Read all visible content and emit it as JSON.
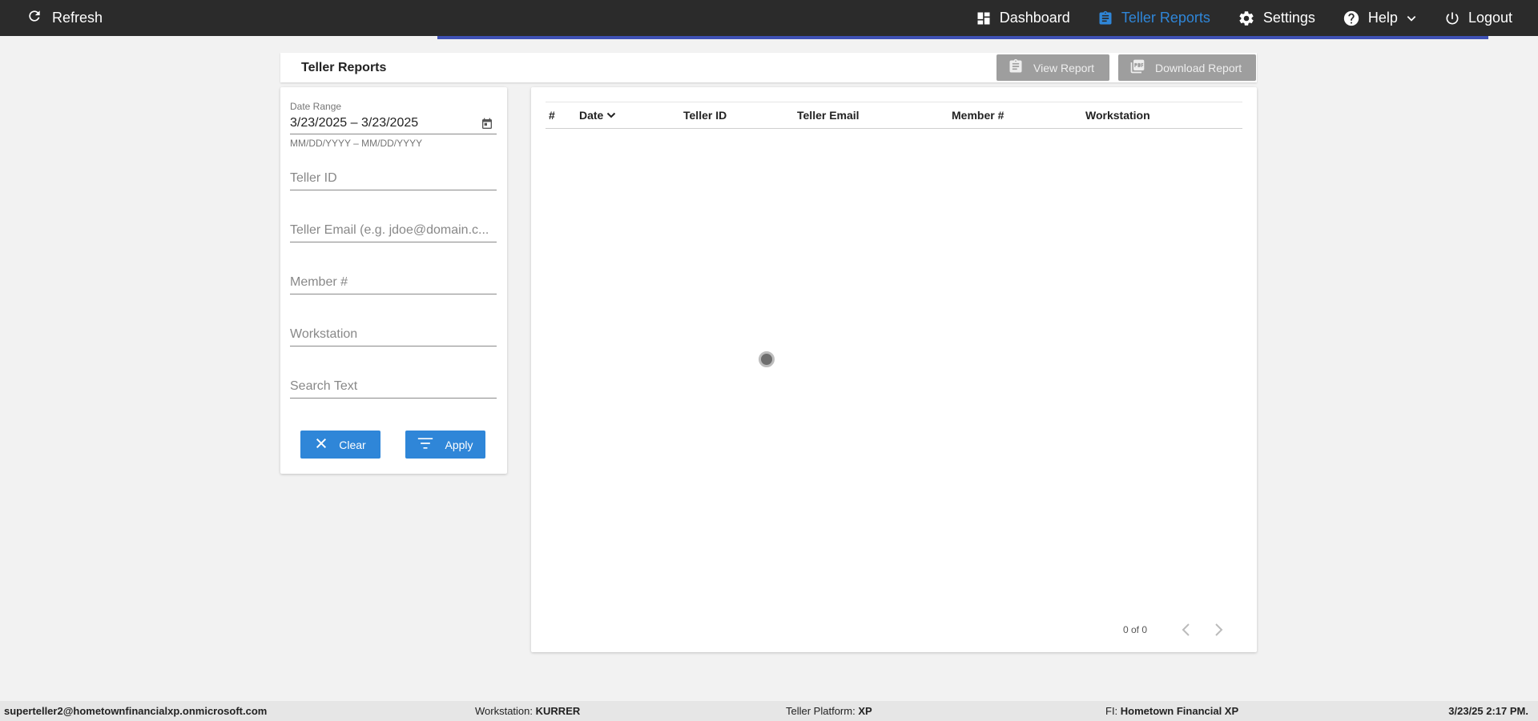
{
  "topbar": {
    "refresh_label": "Refresh",
    "nav": {
      "dashboard": "Dashboard",
      "teller_reports": "Teller Reports",
      "settings": "Settings",
      "help": "Help",
      "logout": "Logout"
    }
  },
  "header": {
    "title": "Teller Reports",
    "view_report": "View Report",
    "download_report": "Download Report"
  },
  "filters": {
    "date_range_label": "Date Range",
    "date_range_value": "3/23/2025 – 3/23/2025",
    "date_range_hint": "MM/DD/YYYY – MM/DD/YYYY",
    "teller_id_placeholder": "Teller ID",
    "teller_email_placeholder": "Teller Email (e.g. jdoe@domain.c...",
    "member_placeholder": "Member #",
    "workstation_placeholder": "Workstation",
    "search_placeholder": "Search Text",
    "clear_label": "Clear",
    "apply_label": "Apply"
  },
  "table": {
    "columns": [
      "#",
      "Date",
      "Teller ID",
      "Teller Email",
      "Member #",
      "Workstation"
    ],
    "pager": "0 of 0"
  },
  "footer": {
    "user": "superteller2@hometownfinancialxp.onmicrosoft.com",
    "workstation_label": "Workstation:",
    "workstation_value": "KURRER",
    "platform_label": "Teller Platform:",
    "platform_value": "XP",
    "fi_label": "FI:",
    "fi_value": "Hometown Financial XP",
    "datetime": "3/23/25 2:17 PM."
  },
  "colors": {
    "accent": "#2f86d8",
    "topbar": "#2b2b2b",
    "topbar_underline": "#3f51b5"
  }
}
